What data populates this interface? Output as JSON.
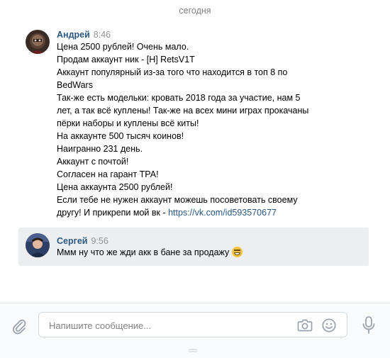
{
  "chat": {
    "date_separator": "сегодня",
    "messages": [
      {
        "author": "Андрей",
        "time": "8:46",
        "lines": [
          "Цена 2500 рублей! Очень мало.",
          "Продам аккаунт ник - [H] RetsV1T",
          "Аккаунт популярный из-за того что находится в топ 8 по",
          "BedWars",
          "Так-же есть модельки: кровать 2018 года за участие, нам 5",
          "лет, а так всё куплены! Так-же на всех мини играх прокачаны",
          "пёрки наборы и куплены всё киты!",
          "На аккаунте 500 тысяч коинов!",
          "Наигранно 231 день.",
          "Аккаунт с почтой!",
          "Согласен на гарант ТРА!",
          "Цена аккаунта 2500 рублей!",
          "Если тебе не нужен аккаунт можешь посоветовать своему"
        ],
        "last_line_text": "другу! И прикрепи мой вк - ",
        "link": "https://vk.com/id593570677"
      },
      {
        "author": "Сергей",
        "time": "9:56",
        "text": "Ммм ну что же жди акк в бане за продажу",
        "emoji": "grinning-squinting-face"
      }
    ]
  },
  "composer": {
    "placeholder": "Напишите сообщение...",
    "icons": [
      "paperclip-icon",
      "camera-icon",
      "smile-icon",
      "microphone-icon"
    ]
  },
  "colors": {
    "author": "#2a5885",
    "link": "#2a5885",
    "time": "#939393",
    "highlight_bg": "#edeef0"
  }
}
